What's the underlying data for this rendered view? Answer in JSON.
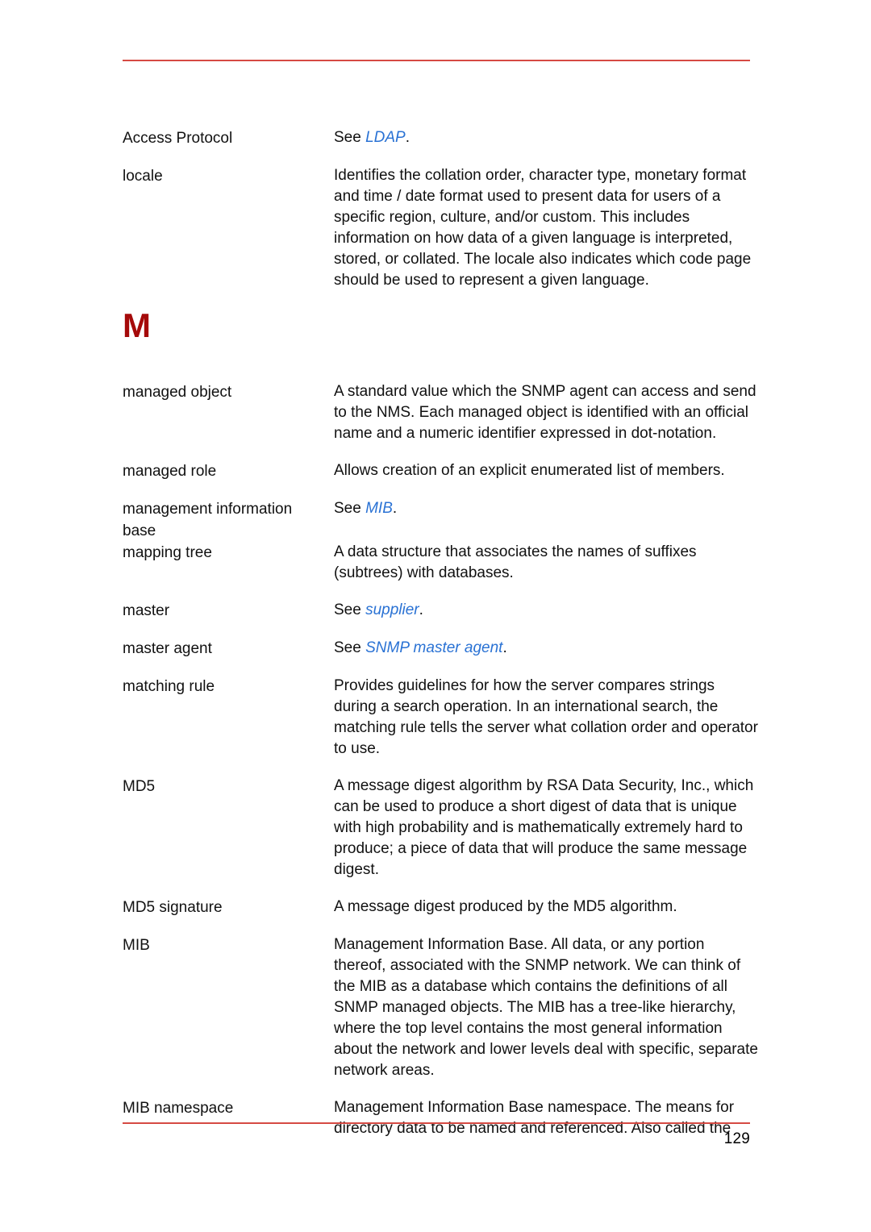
{
  "document": {
    "page_number": "129",
    "rule_color": "#d64a43",
    "heading_color": "#a50a0a",
    "xref_color": "#2a72d4"
  },
  "entries_before_heading": [
    {
      "term": "Access Protocol",
      "def_prefix": "See ",
      "xref": "LDAP",
      "def_suffix": "."
    },
    {
      "term": "locale",
      "definition": "Identifies the collation order, character type, monetary format and time / date format used to present data for users of a specific region, culture, and/or custom. This includes information on how data of a given language is interpreted, stored, or collated. The locale also indicates which code page should be used to represent a given language."
    }
  ],
  "letter_heading": "M",
  "entries_after_heading": [
    {
      "term": "managed object",
      "definition": "A standard value which the SNMP agent can access and send to the NMS. Each managed object is identified with an official name and a numeric identifier expressed in dot-notation."
    },
    {
      "term": "managed role",
      "definition": "Allows creation of an explicit enumerated list of members."
    },
    {
      "term": "management information base",
      "def_prefix": "See ",
      "xref": "MIB",
      "def_suffix": "."
    },
    {
      "term": "mapping tree",
      "definition": "A data structure that associates the names of suffixes (subtrees) with databases."
    },
    {
      "term": "master",
      "def_prefix": "See ",
      "xref": "supplier",
      "def_suffix": "."
    },
    {
      "term": "master agent",
      "def_prefix": "See ",
      "xref": "SNMP master agent",
      "def_suffix": "."
    },
    {
      "term": "matching rule",
      "definition": "Provides guidelines for how the server compares strings during a search operation. In an international search, the matching rule tells the server what collation order and operator to use."
    },
    {
      "term": "MD5",
      "definition": "A message digest algorithm by RSA Data Security, Inc., which can be used to produce a short digest of data that is unique with high probability and is mathematically extremely hard to produce; a piece of data that will produce the same message digest."
    },
    {
      "term": "MD5 signature",
      "definition": "A message digest produced by the MD5 algorithm."
    },
    {
      "term": "MIB",
      "definition": "Management Information Base. All data, or any portion thereof, associated with the SNMP network. We can think of the MIB as a database which contains the definitions of all SNMP managed objects. The MIB has a tree-like hierarchy, where the top level contains the most general information about the network and lower levels deal with specific, separate network areas."
    },
    {
      "term": "MIB namespace",
      "definition": "Management Information Base namespace. The means for directory data to be named and referenced. Also called the"
    }
  ]
}
